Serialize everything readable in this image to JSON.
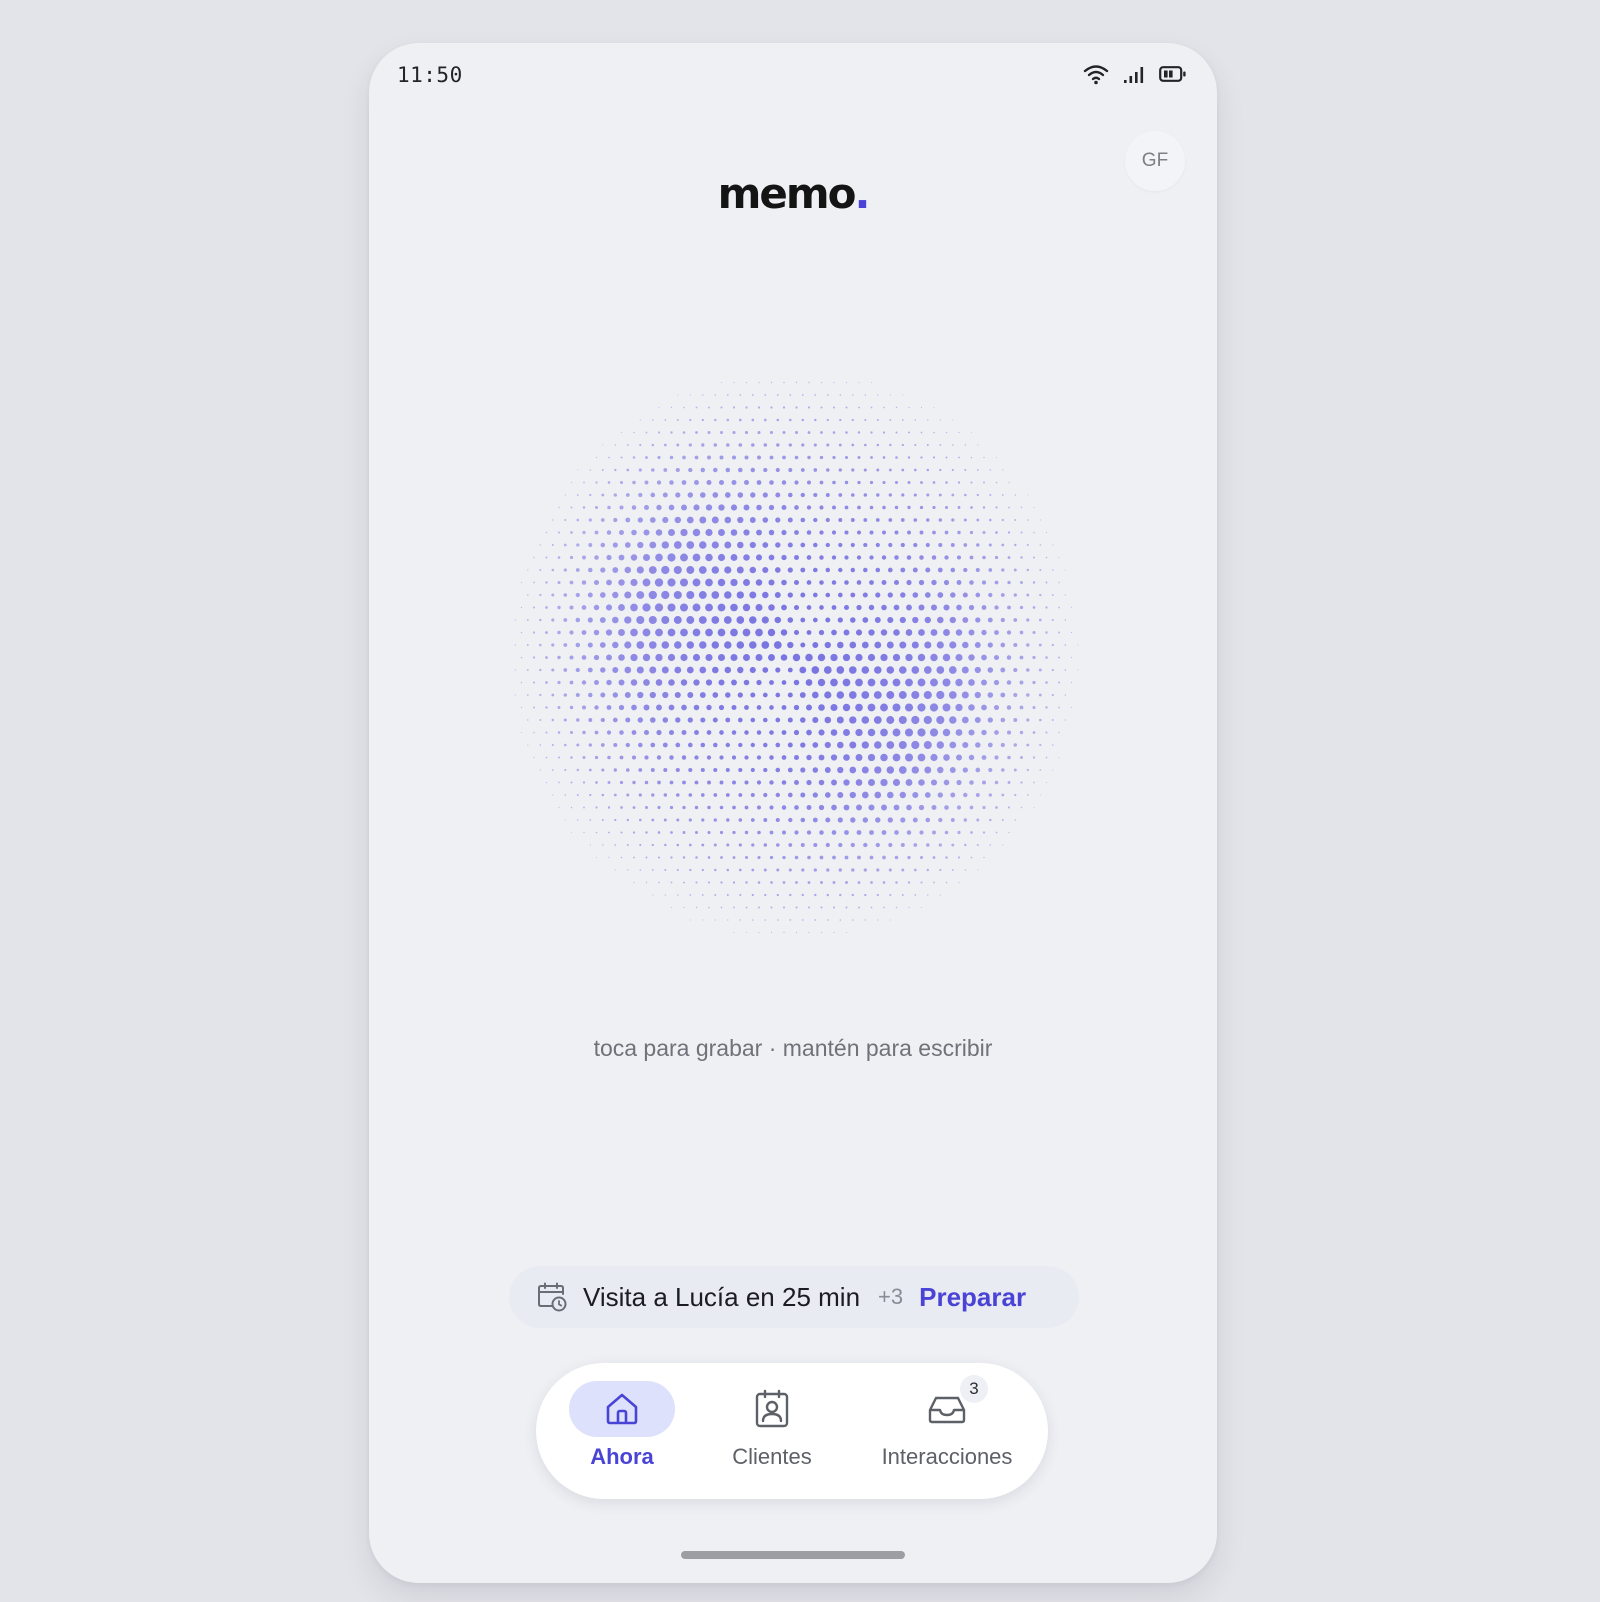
{
  "status_bar": {
    "time": "11:50",
    "icons": [
      "wifi-icon",
      "signal-icon",
      "battery-icon"
    ]
  },
  "header": {
    "logo_text": "memo",
    "logo_dot": ".",
    "avatar_initials": "GF"
  },
  "record": {
    "hint": "toca para grabar · mantén para escribir"
  },
  "upcoming": {
    "icon": "calendar-clock-icon",
    "text": "Visita a Lucía en 25 min",
    "more": "+3",
    "action": "Preparar"
  },
  "nav": {
    "tabs": [
      {
        "label": "Ahora",
        "icon": "home-icon",
        "active": true
      },
      {
        "label": "Clientes",
        "icon": "contact-card-icon",
        "active": false
      },
      {
        "label": "Interacciones",
        "icon": "inbox-icon",
        "active": false,
        "badge": "3"
      }
    ]
  },
  "colors": {
    "accent": "#4a44d6",
    "background": "#eff0f4",
    "orb_dots": "#6e67df"
  }
}
